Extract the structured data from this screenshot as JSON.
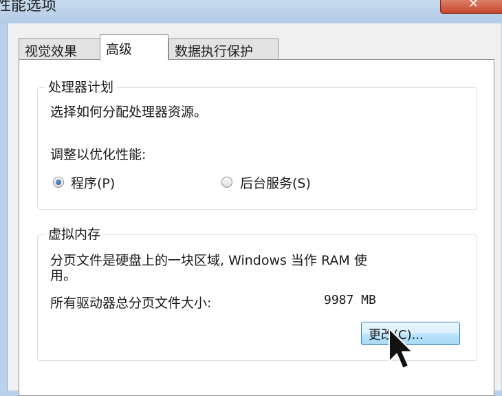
{
  "window": {
    "title": "性能选项",
    "close_label": "✕"
  },
  "tabs": [
    {
      "label": "视觉效果",
      "active": false
    },
    {
      "label": "高级",
      "active": true
    },
    {
      "label": "数据执行保护",
      "active": false
    }
  ],
  "processor": {
    "group_title": "处理器计划",
    "description": "选择如何分配处理器资源。",
    "adjust_label": "调整以优化性能:",
    "options": [
      {
        "label": "程序(P)",
        "selected": true
      },
      {
        "label": "后台服务(S)",
        "selected": false
      }
    ]
  },
  "virtual_memory": {
    "group_title": "虚拟内存",
    "description_line1": "分页文件是硬盘上的一块区域, Windows 当作 RAM 使",
    "description_line2": "用。",
    "total_label": "所有驱动器总分页文件大小:",
    "total_value": "9987 MB",
    "change_button": "更改(C)..."
  },
  "colors": {
    "accent": "#3c7fb1",
    "radio_selected": "#1f4f9e"
  }
}
